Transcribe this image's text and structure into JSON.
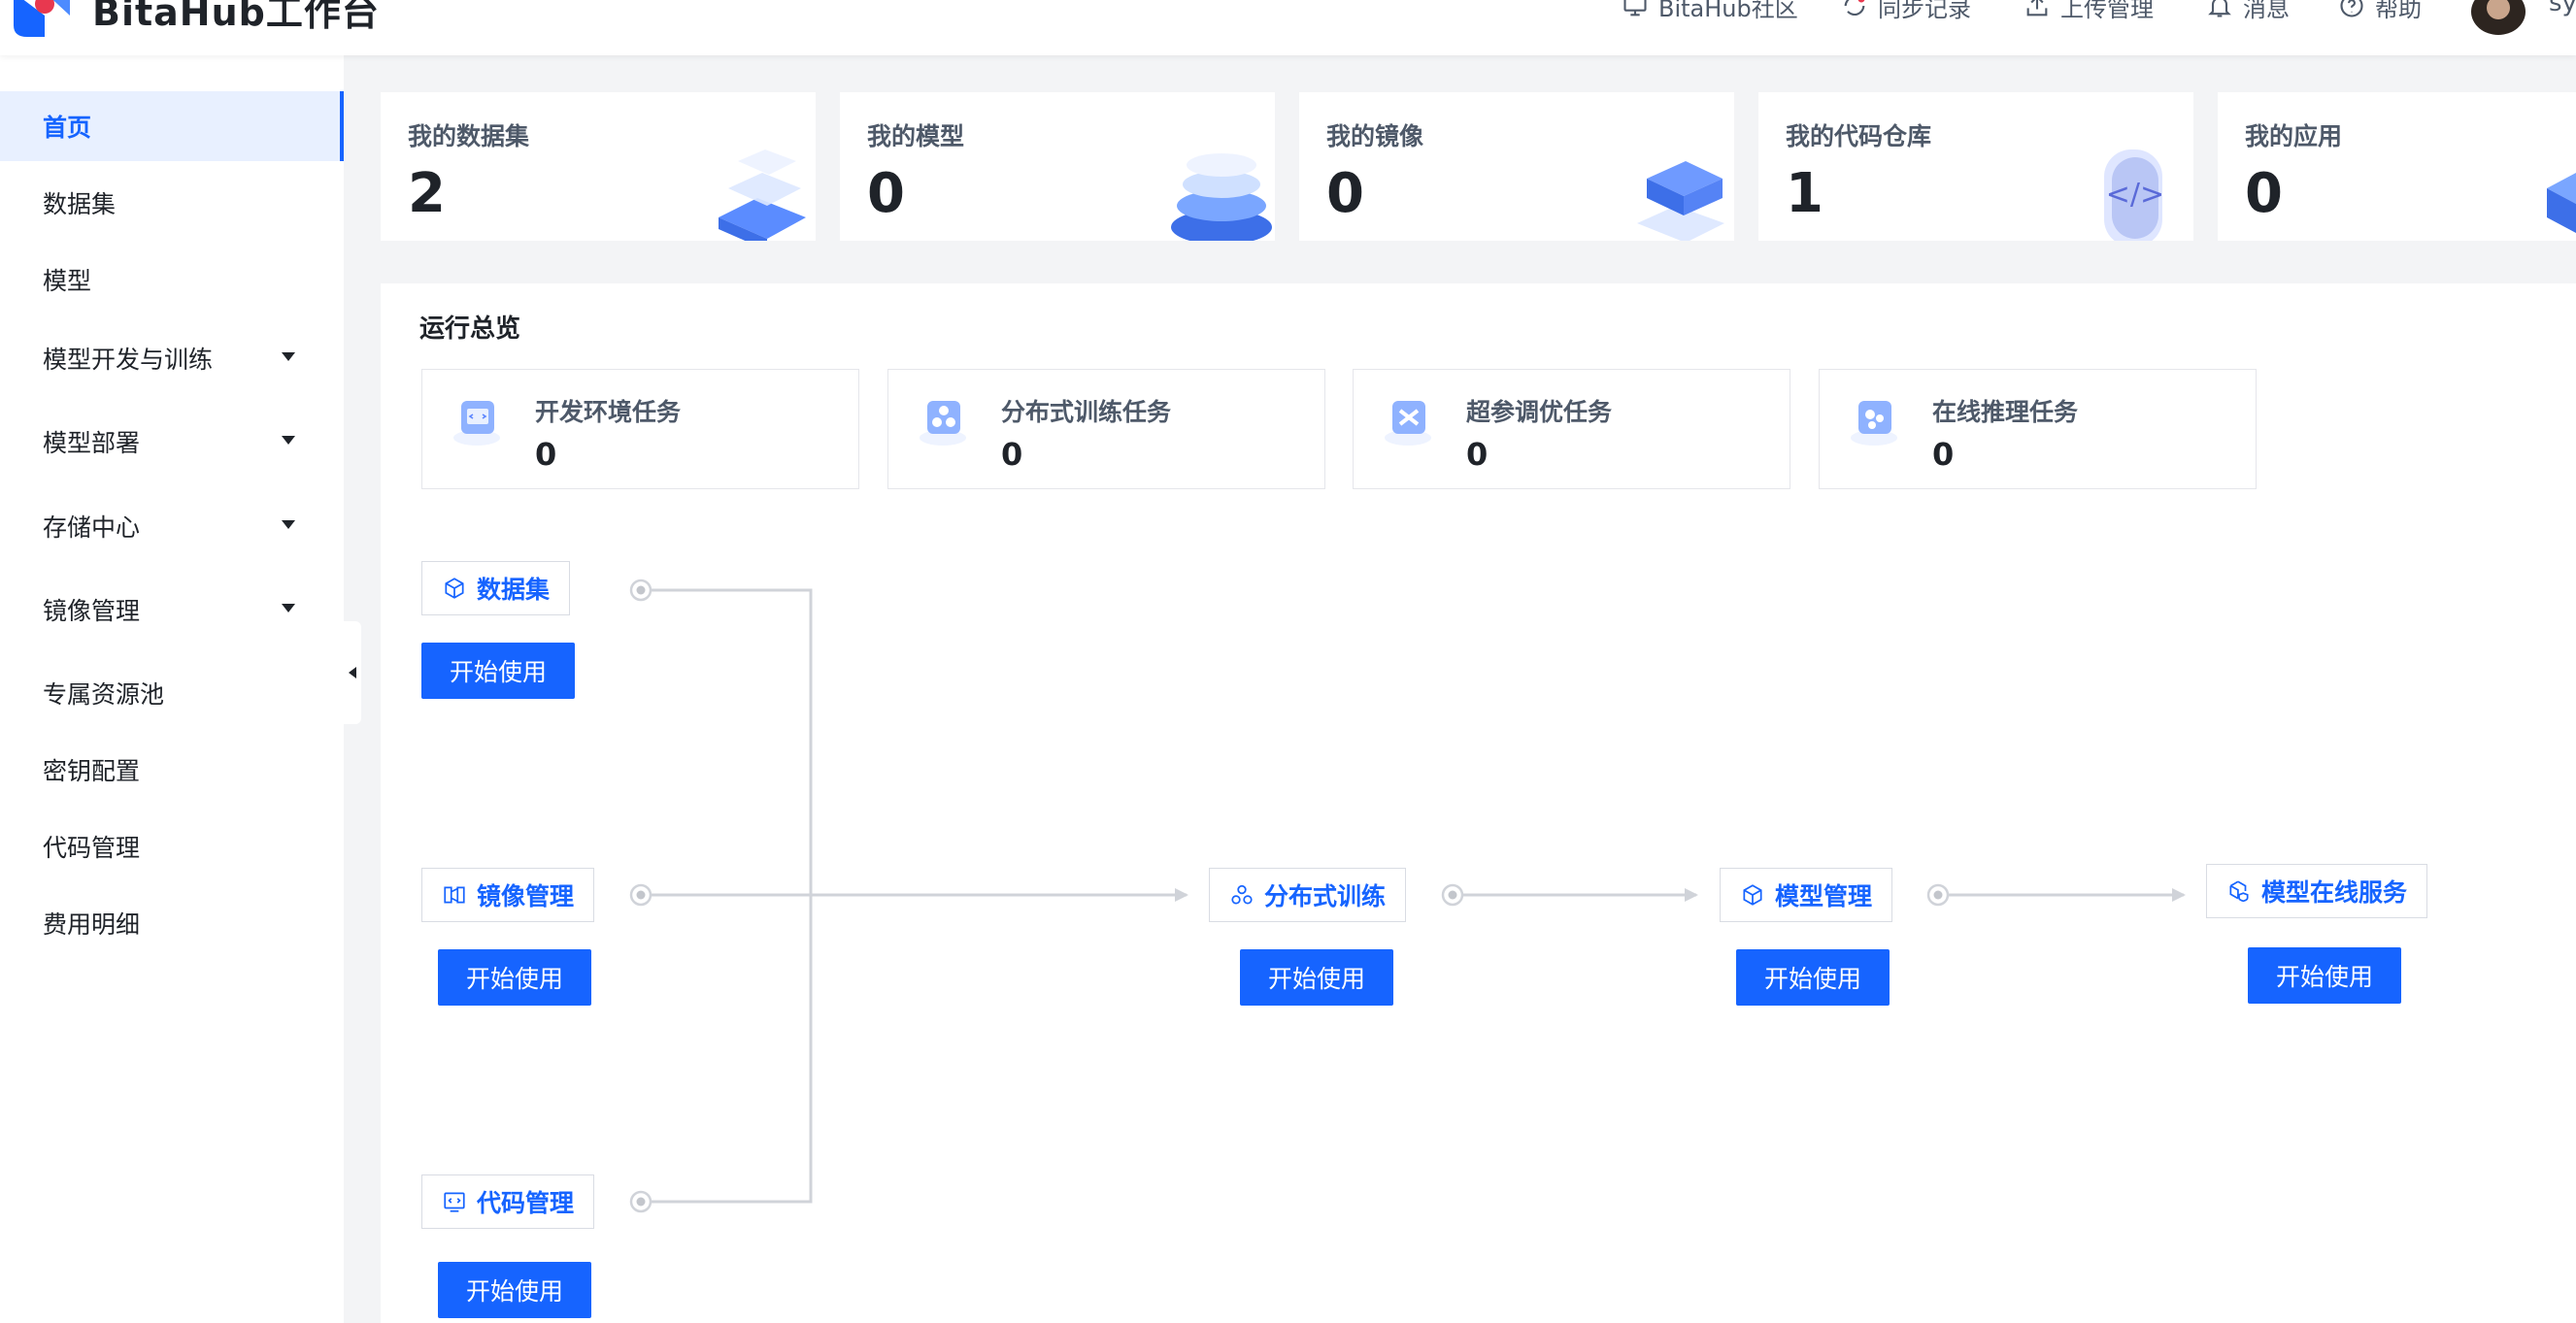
{
  "header": {
    "brand": "BitaHub工作台",
    "nav": [
      {
        "label": "BitaHub社区",
        "icon": "monitor-icon"
      },
      {
        "label": "同步记录",
        "icon": "sync-icon"
      },
      {
        "label": "上传管理",
        "icon": "upload-icon"
      },
      {
        "label": "消息",
        "icon": "bell-icon"
      },
      {
        "label": "帮助",
        "icon": "help-icon"
      }
    ],
    "user_name": "sy"
  },
  "sidebar": {
    "items": [
      {
        "label": "首页",
        "active": true
      },
      {
        "label": "数据集"
      },
      {
        "label": "模型"
      },
      {
        "label": "模型开发与训练",
        "expandable": true
      },
      {
        "label": "模型部署",
        "expandable": true
      },
      {
        "label": "存储中心",
        "expandable": true
      },
      {
        "label": "镜像管理",
        "expandable": true
      },
      {
        "label": "专属资源池"
      },
      {
        "label": "密钥配置"
      },
      {
        "label": "代码管理"
      },
      {
        "label": "费用明细"
      }
    ]
  },
  "stats": [
    {
      "label": "我的数据集",
      "value": "2"
    },
    {
      "label": "我的模型",
      "value": "0"
    },
    {
      "label": "我的镜像",
      "value": "0"
    },
    {
      "label": "我的代码仓库",
      "value": "1"
    },
    {
      "label": "我的应用",
      "value": "0"
    }
  ],
  "overview": {
    "title": "运行总览",
    "tasks": [
      {
        "label": "开发环境任务",
        "value": "0"
      },
      {
        "label": "分布式训练任务",
        "value": "0"
      },
      {
        "label": "超参调优任务",
        "value": "0"
      },
      {
        "label": "在线推理任务",
        "value": "0"
      }
    ]
  },
  "flow": {
    "nodes": {
      "dataset": "数据集",
      "image": "镜像管理",
      "code": "代码管理",
      "training": "分布式训练",
      "model": "模型管理",
      "service": "模型在线服务"
    },
    "start_label": "开始使用"
  },
  "colors": {
    "accent": "#1664ff",
    "active_bg": "#e8f0ff",
    "line": "#d0d3d9"
  }
}
